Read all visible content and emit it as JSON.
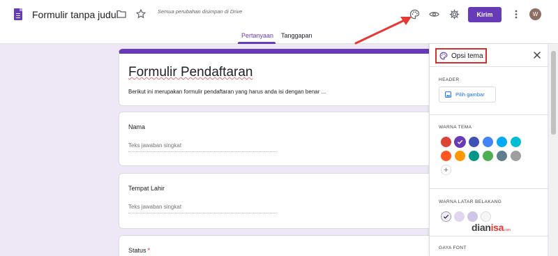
{
  "header": {
    "app_title": "Formulir tanpa judul",
    "save_status": "Semua perubahan disimpan di Drive",
    "send_label": "Kirim",
    "avatar_initial": "W",
    "icons": [
      "form-doc-icon",
      "folder-icon",
      "star-icon",
      "palette-icon",
      "eye-icon",
      "gear-icon",
      "more-vert-icon"
    ]
  },
  "tabs": [
    {
      "label": "Pertanyaan",
      "active": true
    },
    {
      "label": "Tanggapan",
      "active": false
    }
  ],
  "form": {
    "title": "Formulir Pendaftaran",
    "description": "Berikut ini merupakan formulir pendaftaran yang harus anda isi dengan benar ...",
    "questions": [
      {
        "label": "Nama",
        "answer_placeholder": "Teks jawaban singkat",
        "required": false
      },
      {
        "label": "Tempat Lahir",
        "answer_placeholder": "Teks jawaban singkat",
        "required": false
      },
      {
        "label": "Status",
        "required": true,
        "required_mark": "*"
      }
    ]
  },
  "theme_panel": {
    "title": "Opsi tema",
    "header_section": {
      "label": "HEADER",
      "button_label": "Pilih gambar"
    },
    "theme_color_section": {
      "label": "WARNA TEMA",
      "selected": "#673ab7",
      "colors": [
        "#db4437",
        "#673ab7",
        "#3f51b5",
        "#4285f4",
        "#03a9f4",
        "#00bcd4",
        "#ff5722",
        "#ff9800",
        "#009688",
        "#4caf50",
        "#607d8b",
        "#9e9e9e"
      ],
      "add_label": "+"
    },
    "background_section": {
      "label": "WARNA LATAR BELAKANG",
      "colors": [
        "#f0ebf8",
        "#e1d5f2",
        "#d1c4e9",
        "#f6f6f6"
      ],
      "selected_index": 0
    },
    "font_section": {
      "label": "GAYA FONT"
    }
  },
  "watermark": {
    "part1": "dian",
    "part2": "isa",
    "tail": ".com"
  },
  "colors": {
    "accent": "#673ab7",
    "annotation_red": "#d32f2f"
  }
}
